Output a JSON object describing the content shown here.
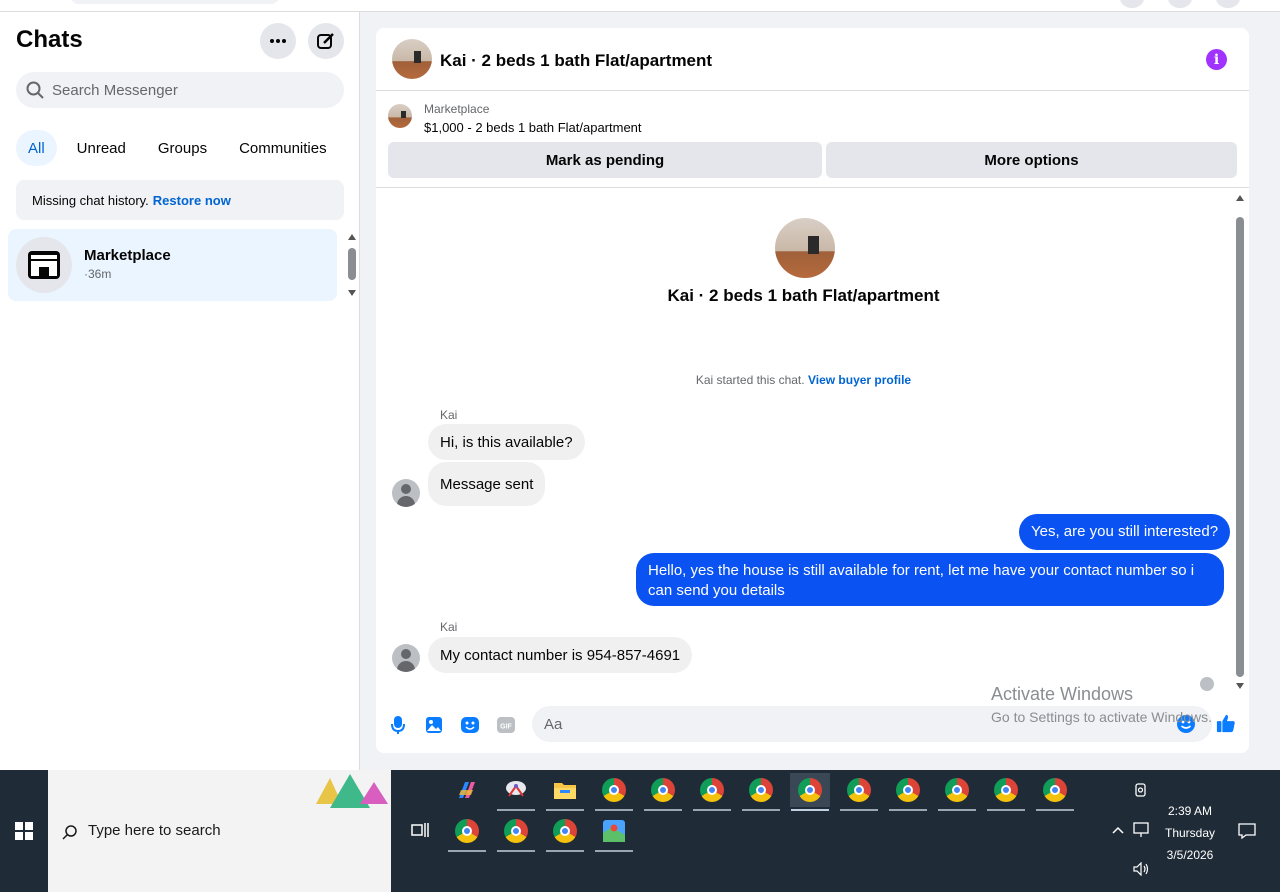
{
  "left": {
    "title": "Chats",
    "search_placeholder": "Search Messenger",
    "tabs": [
      "All",
      "Unread",
      "Groups",
      "Communities"
    ],
    "restore_text": "Missing chat history.",
    "restore_link": "Restore now",
    "chat": {
      "name": "Marketplace",
      "time": "·36m"
    }
  },
  "conversation": {
    "title": "Kai · 2 beds 1 bath Flat/apartment",
    "marketplace_label": "Marketplace",
    "listing": "$1,000 - 2 beds 1 bath Flat/apartment",
    "mark_pending": "Mark as pending",
    "more_options": "More options",
    "center_title": "Kai · 2 beds 1 bath Flat/apartment",
    "started_text": "Kai started this chat.",
    "view_profile": "View buyer profile",
    "messages": [
      {
        "sender": "Kai",
        "text": "Hi, is this available?"
      },
      {
        "text": "Message sent"
      },
      {
        "text": "Yes, are you still interested?"
      },
      {
        "text": "Hello, yes the house is still available for rent, let me have your contact number so i can send you details"
      },
      {
        "sender": "Kai",
        "text": "My contact number is 954-857-4691"
      }
    ],
    "composer_placeholder": "Aa"
  },
  "watermark": {
    "line1": "Activate Windows",
    "line2": "Go to Settings to activate Windows."
  },
  "taskbar": {
    "search_text": "Type here to search",
    "time": "2:39 AM",
    "day": "Thursday",
    "date": "3/5/2026"
  },
  "colors": {
    "accent": "#0064d1",
    "outgoing_bubble": "#0a53f2",
    "info_icon": "#a033ff",
    "taskbar": "#1f2b36"
  }
}
